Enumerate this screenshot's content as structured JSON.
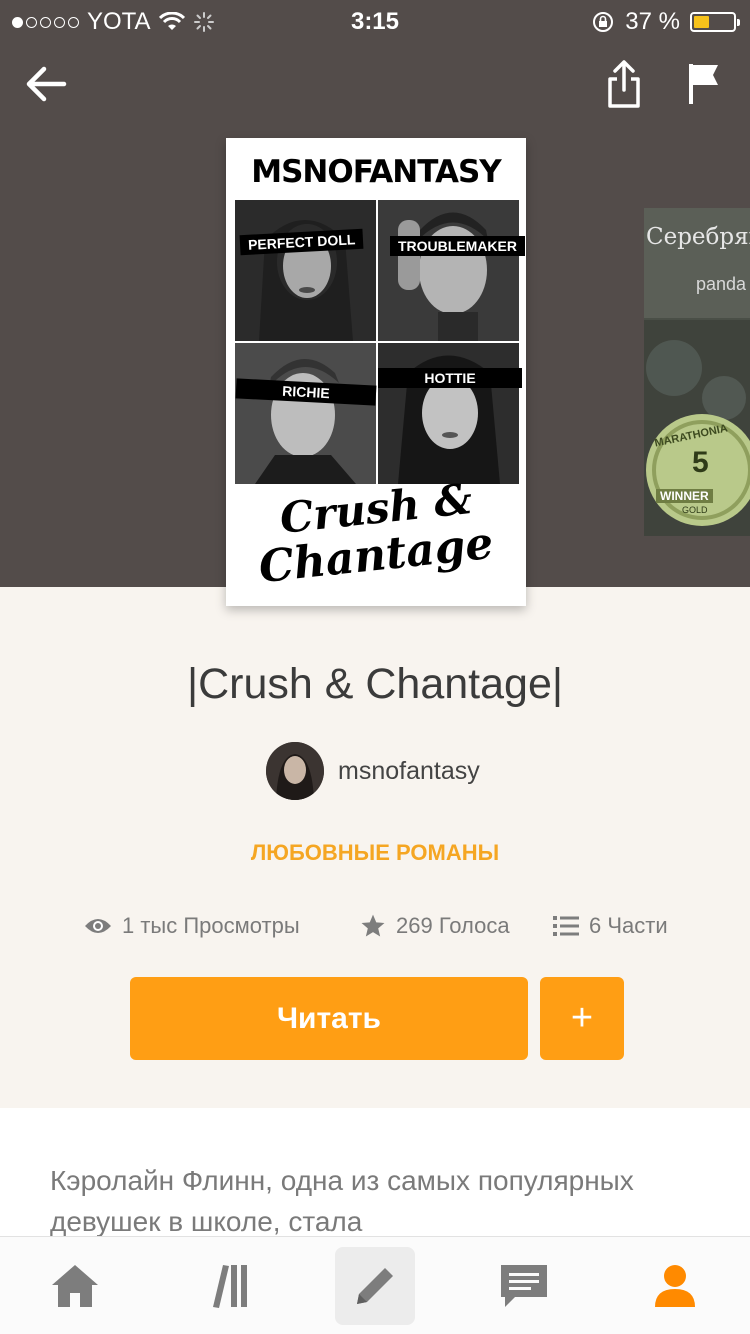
{
  "status_bar": {
    "carrier": "YOTA",
    "time": "3:15",
    "battery_percent": "37 %",
    "signal_bars_filled": 1,
    "signal_bars_total": 5
  },
  "toolbar": {
    "back_icon": "back-arrow-icon",
    "share_icon": "share-icon",
    "report_icon": "flag-icon"
  },
  "cover": {
    "author_text": "MSNOFANTASY",
    "tags": [
      "PERFECT DOLL",
      "TROUBLEMAKER",
      "RICHIE",
      "HOTTIE"
    ],
    "title_line1": "Crush &",
    "title_line2": "Chantage"
  },
  "next_cover": {
    "title": "Серебрян",
    "sub": "panda",
    "badge_top": "MARATHONIA",
    "badge_number": "5",
    "badge_word": "WINNER",
    "badge_level": "GOLD"
  },
  "book": {
    "title": "|Crush & Chantage|",
    "author": "msnofantasy",
    "genre": "ЛЮБОВНЫЕ РОМАНЫ"
  },
  "stats": {
    "views": "1 тыс Просмотры",
    "votes": "269 Голоса",
    "parts": "6 Части"
  },
  "actions": {
    "read_label": "Читать",
    "add_label": "+"
  },
  "description": "Кэролайн Флинн, одна из самых популярных девушек в школе, стала",
  "colors": {
    "accent": "#ff9e14",
    "genre": "#f5a623",
    "hero_bg": "#534c4a"
  },
  "tab_bar": {
    "items": [
      {
        "icon": "home-icon"
      },
      {
        "icon": "library-icon"
      },
      {
        "icon": "pencil-icon",
        "active": true
      },
      {
        "icon": "messages-icon"
      },
      {
        "icon": "profile-icon"
      }
    ]
  }
}
